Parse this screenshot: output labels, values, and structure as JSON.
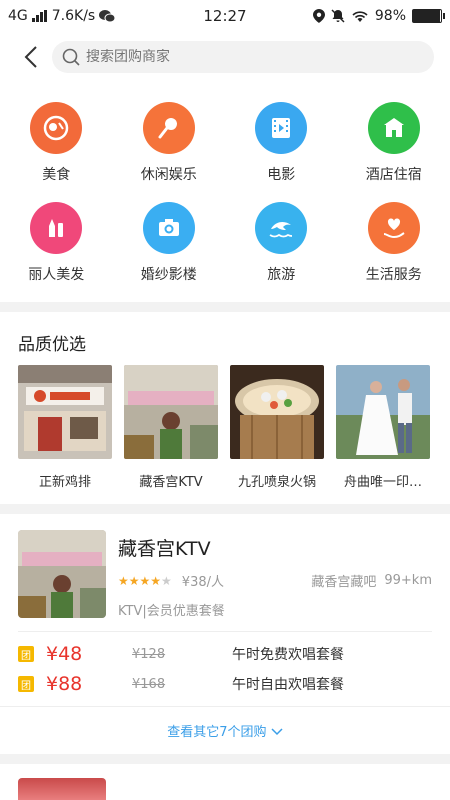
{
  "status_bar": {
    "network": "4G",
    "speed": "7.6K/s",
    "time": "12:27",
    "battery": "98%",
    "battery_level": 0.98
  },
  "search": {
    "placeholder": "搜索团购商家"
  },
  "categories": [
    {
      "label": "美食",
      "icon": "food-icon",
      "color": "#f26a3a"
    },
    {
      "label": "休闲娱乐",
      "icon": "microphone-icon",
      "color": "#f5733a"
    },
    {
      "label": "电影",
      "icon": "film-icon",
      "color": "#3aa8f0"
    },
    {
      "label": "酒店住宿",
      "icon": "hotel-icon",
      "color": "#2fbf4a"
    },
    {
      "label": "丽人美发",
      "icon": "lipstick-icon",
      "color": "#f0487a"
    },
    {
      "label": "婚纱影楼",
      "icon": "camera-icon",
      "color": "#3aaef2"
    },
    {
      "label": "旅游",
      "icon": "dolphin-icon",
      "color": "#38b2ee"
    },
    {
      "label": "生活服务",
      "icon": "heart-hand-icon",
      "color": "#f5733a"
    }
  ],
  "quality": {
    "title": "品质优选",
    "items": [
      {
        "label": "正新鸡排"
      },
      {
        "label": "藏香宫KTV"
      },
      {
        "label": "九孔喷泉火锅"
      },
      {
        "label": "舟曲唯一印…"
      }
    ]
  },
  "deal": {
    "name": "藏香宫KTV",
    "rating": 4,
    "price_per": "¥38/人",
    "location": "藏香宫藏吧",
    "distance": "99+km",
    "tag": "KTV|会员优惠套餐",
    "badge": "团",
    "offers": [
      {
        "price": "¥48",
        "original": "¥128",
        "desc": "午时免费欢唱套餐"
      },
      {
        "price": "¥88",
        "original": "¥168",
        "desc": "午时自由欢唱套餐"
      }
    ],
    "more_label": "查看其它7个团购"
  }
}
